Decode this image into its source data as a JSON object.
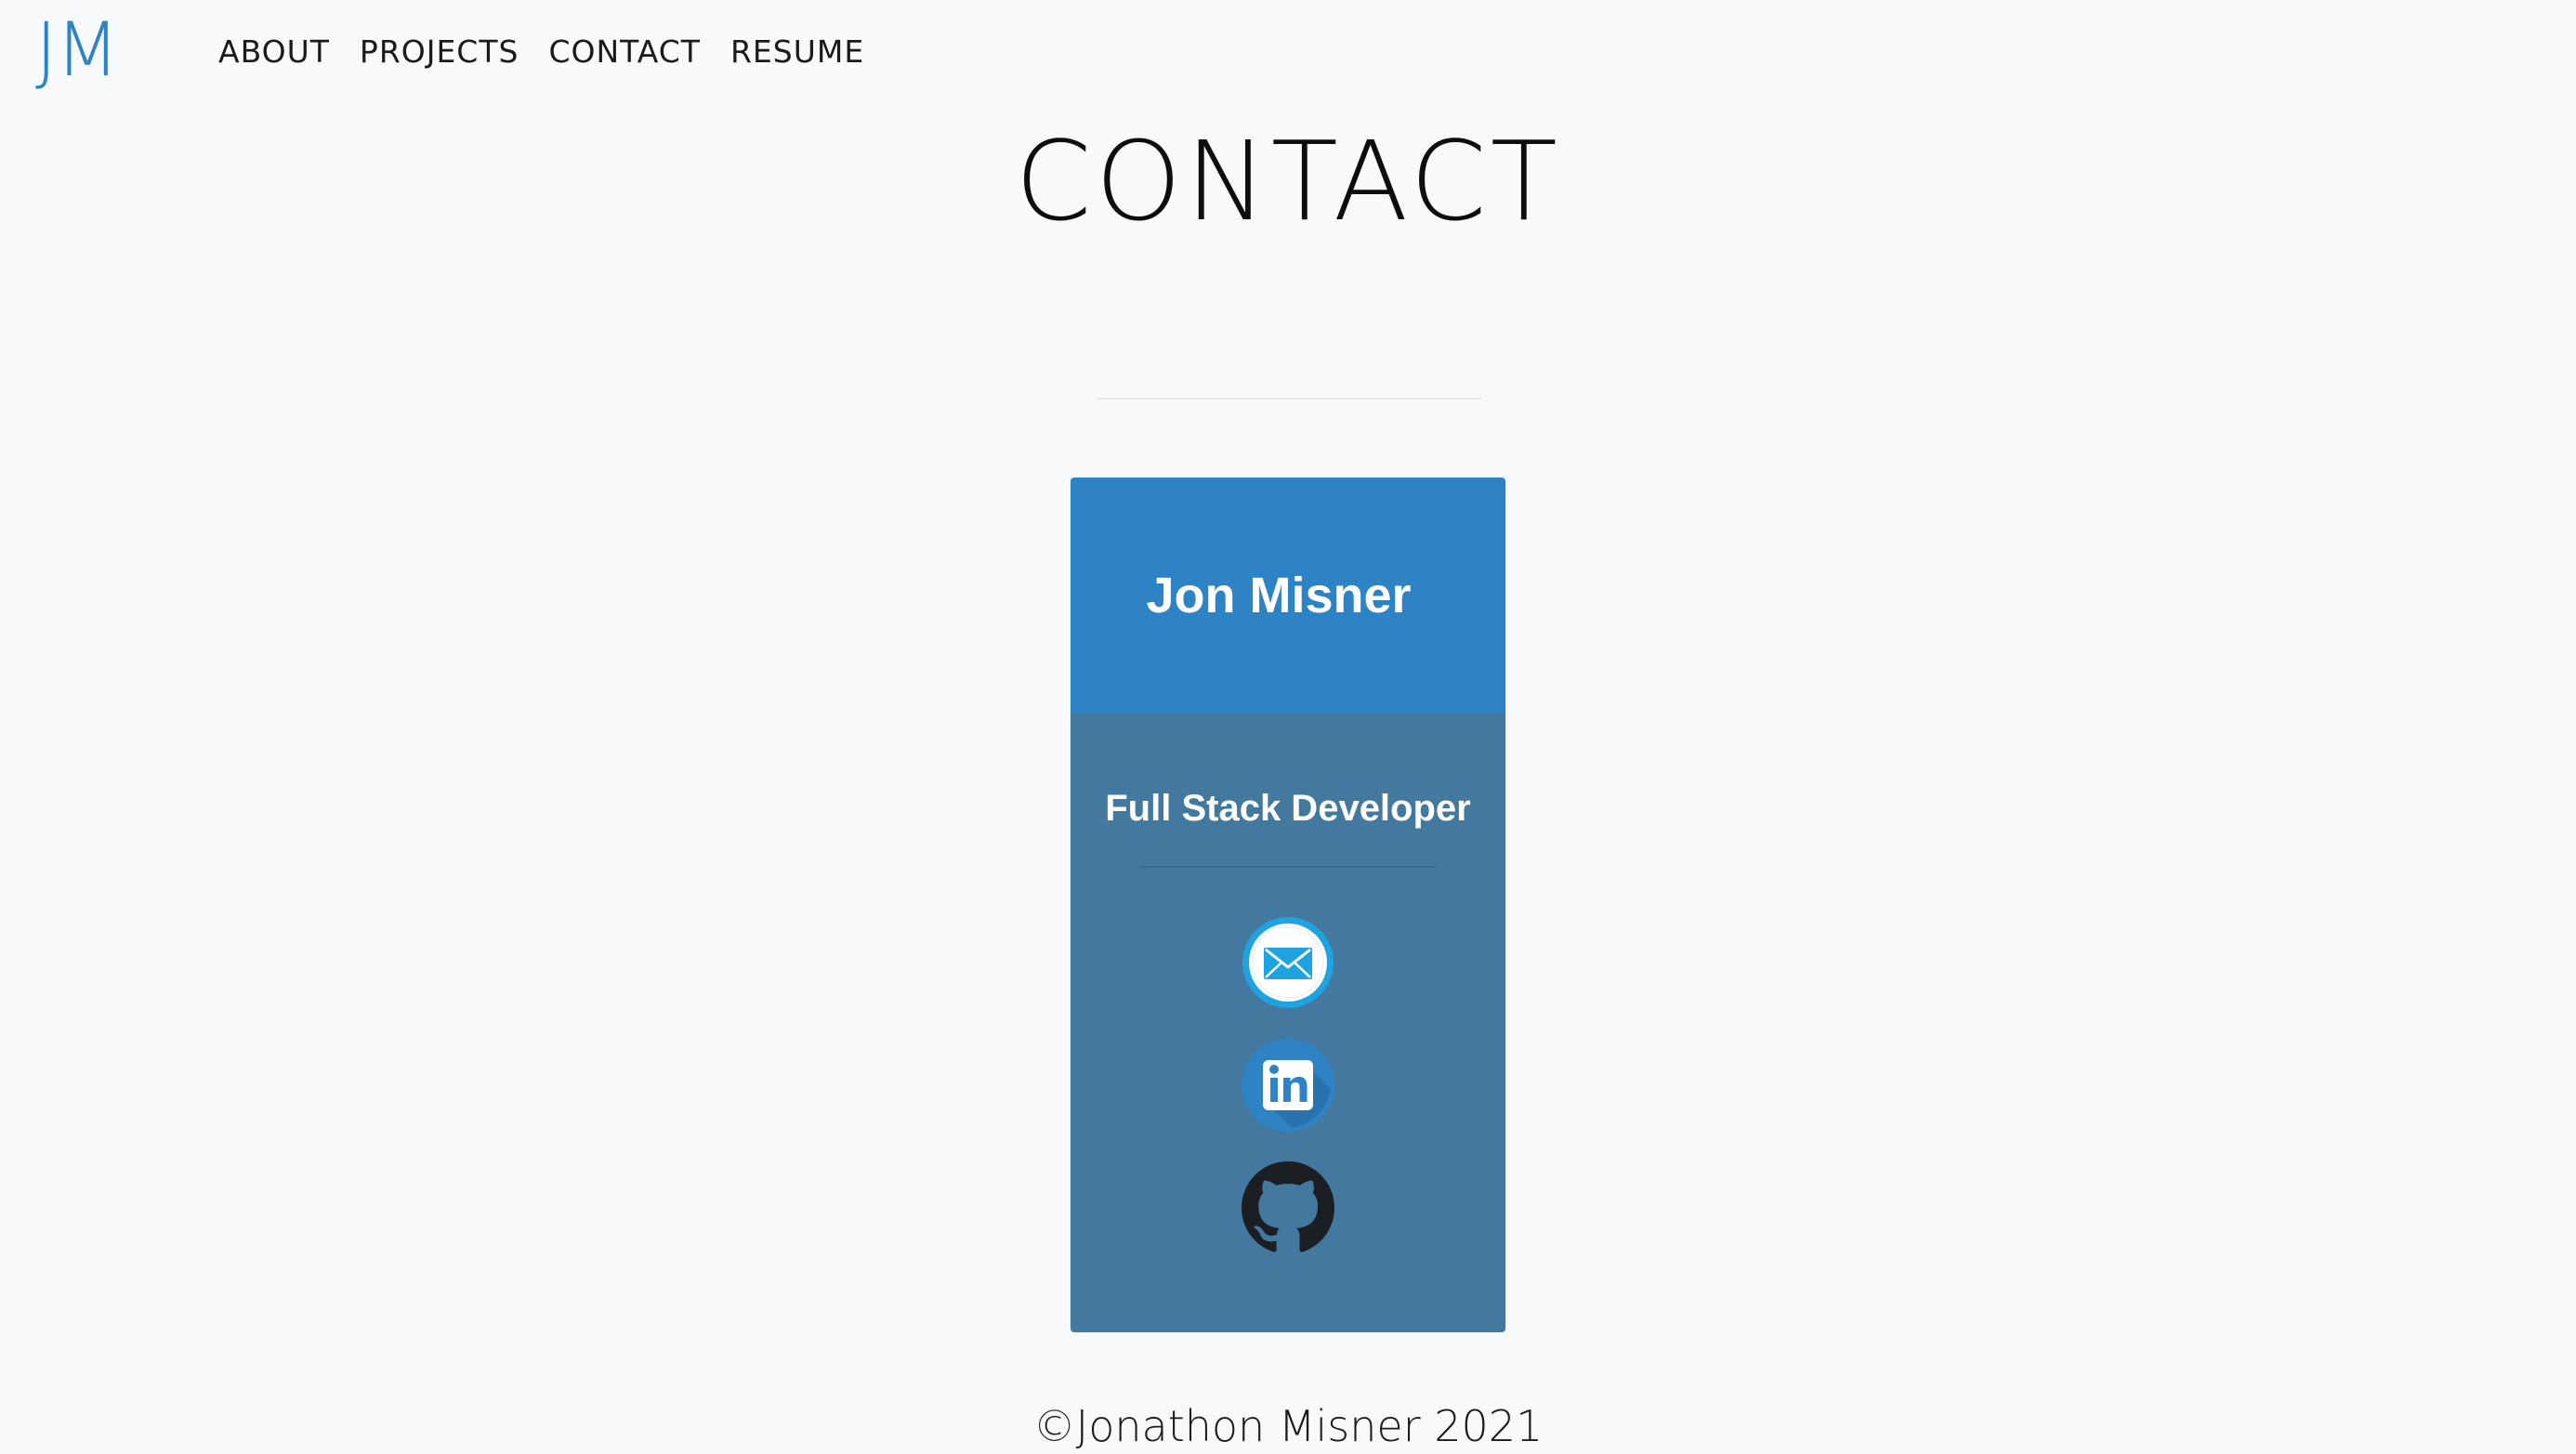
{
  "brand": {
    "logo": "JM",
    "color": "#2e83c4"
  },
  "nav": {
    "items": [
      {
        "label": "ABOUT"
      },
      {
        "label": "PROJECTS"
      },
      {
        "label": "CONTACT"
      },
      {
        "label": "RESUME"
      }
    ]
  },
  "page": {
    "title": "CONTACT"
  },
  "card": {
    "name": "Jon Misner",
    "role": "Full Stack Developer",
    "header_color": "#2e83c4",
    "body_color": "#43799f",
    "links": [
      {
        "icon": "email-icon"
      },
      {
        "icon": "linkedin-icon"
      },
      {
        "icon": "github-icon"
      }
    ]
  },
  "footer": {
    "text": "©Jonathon Misner 2021"
  }
}
